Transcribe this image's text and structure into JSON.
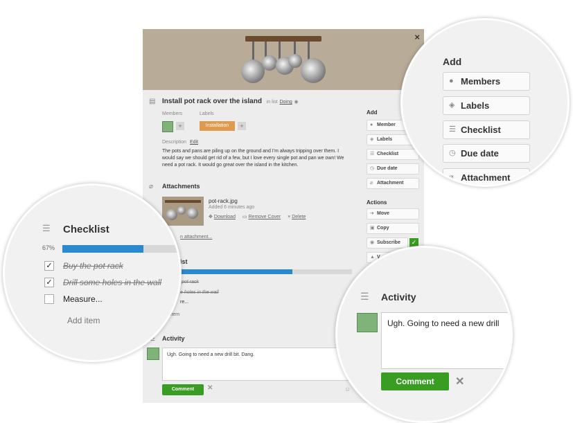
{
  "card": {
    "close_icon": "×",
    "title": "Install pot rack over the island",
    "in_list_prefix": "in list",
    "list_name": "Doing",
    "members_label": "Members",
    "labels_label": "Labels",
    "label_installation": "Installation",
    "description_label": "Description",
    "edit_link": "Edit",
    "description": "The pots and pans are piling up on the ground and I'm always tripping over them. I would say we should get rid of a few, but I love every single pot and pan we own! We need a pot rack. It would go great over the island in the kitchen.",
    "attachments_heading": "Attachments",
    "attachment_name": "pot-rack.jpg",
    "attachment_added": "Added 6 minutes ago",
    "download": "Download",
    "remove_cover": "Remove Cover",
    "delete": "Delete",
    "add_attachment_partial": "n attachment...",
    "checklist_partial": "ist",
    "item1_partial": "pot rack",
    "item2_partial": "e holes in the wall",
    "item3_partial": "re...",
    "add_item_partial": "d item",
    "activity_heading": "Activity",
    "comment_text": "Ugh. Going to need a new drill bit. Dang.",
    "comment_button": "Comment"
  },
  "sidebar": {
    "add_heading": "Add",
    "add_items": [
      "Member",
      "Labels",
      "Checklist",
      "Due date",
      "Attachment"
    ],
    "actions_heading": "Actions",
    "action_items": [
      "Move",
      "Copy",
      "Subscribe",
      "V"
    ]
  },
  "zoom_add": {
    "heading": "Add",
    "items": [
      "Members",
      "Labels",
      "Checklist",
      "Due date",
      "Attachment"
    ]
  },
  "zoom_checklist": {
    "heading": "Checklist",
    "percent": "67%",
    "progress": 0.67,
    "items": [
      {
        "text": "Buy the pot rack",
        "done": true
      },
      {
        "text": "Drill some holes in the wall",
        "done": true
      },
      {
        "text": "Measure...",
        "done": false
      }
    ],
    "add_item": "Add item"
  },
  "zoom_activity": {
    "heading": "Activity",
    "comment_text": "Ugh. Going to need a new drill",
    "comment_button": "Comment"
  },
  "colors": {
    "accent_green": "#3a9d23",
    "progress_blue": "#2a8ad0",
    "label_orange": "#e09a4e"
  }
}
